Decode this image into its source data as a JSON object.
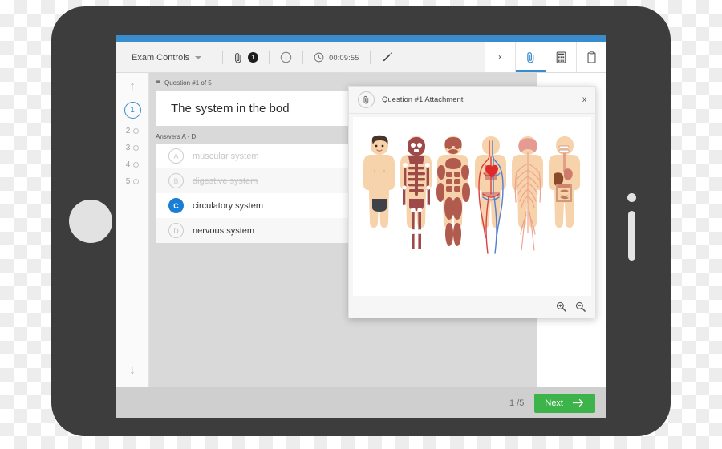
{
  "appbar": {
    "exam_controls_label": "Exam Controls",
    "attachment_count": "1",
    "timer": "00:09:55",
    "icons": {
      "paperclip": "paperclip-icon",
      "info": "info-icon",
      "clock": "clock-icon",
      "pencil": "pencil-icon",
      "caret": "chevron-down-icon"
    },
    "right_tabs": [
      {
        "label": "x",
        "name": "strikeout-tool-tab",
        "active": false
      },
      {
        "label": "",
        "name": "attachment-tool-tab",
        "active": true
      },
      {
        "label": "",
        "name": "calculator-tool-tab",
        "active": false
      },
      {
        "label": "",
        "name": "notes-tool-tab",
        "active": false
      }
    ]
  },
  "rail": {
    "up_arrow": "↑",
    "down_arrow": "↓",
    "questions": [
      {
        "num": "1",
        "current": true
      },
      {
        "num": "2",
        "current": false
      },
      {
        "num": "3",
        "current": false
      },
      {
        "num": "4",
        "current": false
      },
      {
        "num": "5",
        "current": false
      }
    ]
  },
  "question": {
    "flag_icon": "flag-icon",
    "header": "Question #1 of 5",
    "text": "The system in the bod",
    "answers_label": "Answers A - D",
    "options": [
      {
        "letter": "A",
        "text": "muscular system",
        "state": "eliminated"
      },
      {
        "letter": "B",
        "text": "digestive system",
        "state": "eliminated"
      },
      {
        "letter": "C",
        "text": "circulatory system",
        "state": "selected"
      },
      {
        "letter": "D",
        "text": "nervous system",
        "state": "normal"
      }
    ]
  },
  "bottombar": {
    "page_indicator": "1 /5",
    "next_label": "Next",
    "next_arrow_icon": "arrow-right-icon",
    "next_color": "#3cb44a"
  },
  "modal": {
    "title": "Question #1 Attachment",
    "clip_icon": "paperclip-icon",
    "close_label": "x",
    "zoom_in_icon": "zoom-in-icon",
    "zoom_out_icon": "zoom-out-icon",
    "figures": [
      {
        "name": "human-body-figure",
        "label": "body"
      },
      {
        "name": "skeletal-system-figure",
        "label": "skeletal"
      },
      {
        "name": "muscular-system-figure",
        "label": "muscular"
      },
      {
        "name": "circulatory-system-figure",
        "label": "circulatory"
      },
      {
        "name": "nervous-system-figure",
        "label": "nervous"
      },
      {
        "name": "digestive-system-figure",
        "label": "digestive"
      }
    ]
  },
  "colors": {
    "accent_blue": "#3a8dcc",
    "selected_blue": "#1a7fd4",
    "next_green": "#3cb44a",
    "tablet_body": "#3d3d3d",
    "skin": "#f7d3ab",
    "bone": "#9e4a4a",
    "muscle": "#b15a4e",
    "vein_blue": "#4e7fd4",
    "artery_red": "#d94040",
    "nerve": "#efa490",
    "organ": "#d2836d"
  }
}
